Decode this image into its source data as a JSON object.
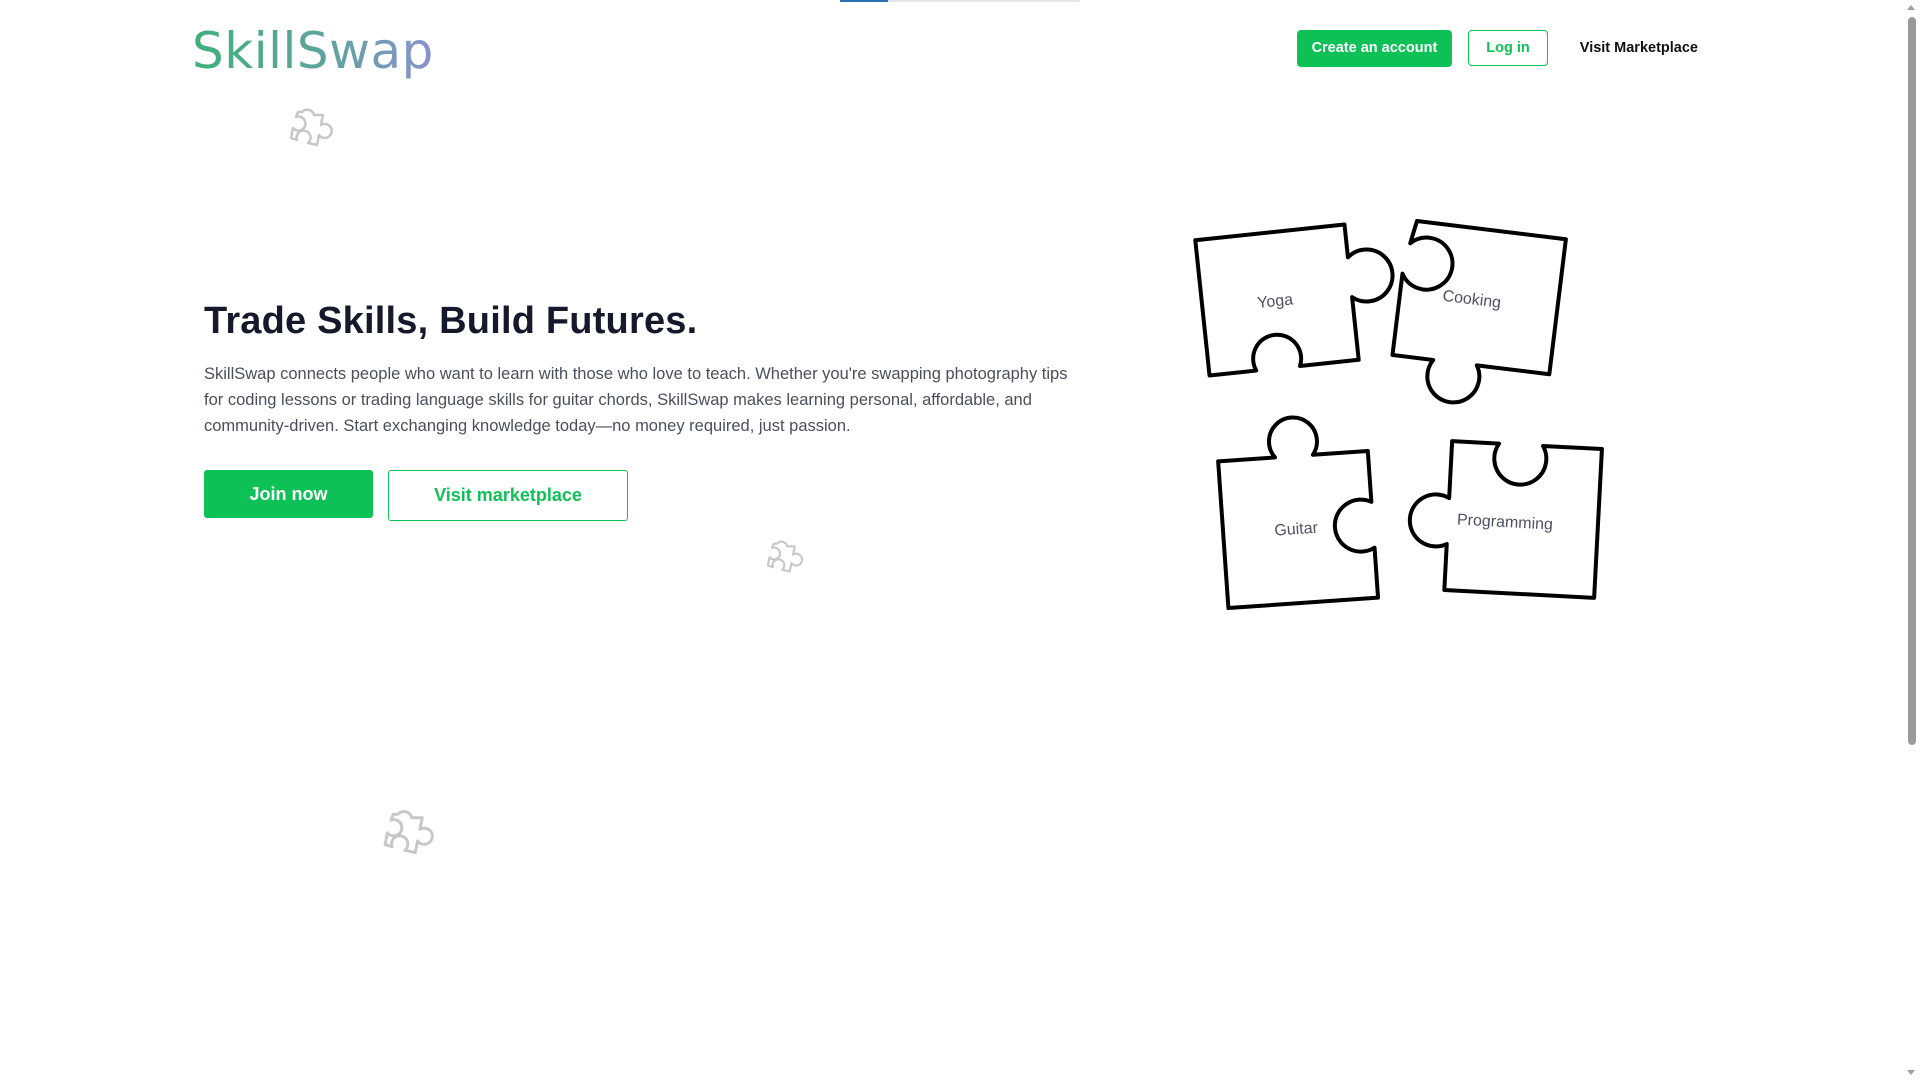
{
  "app": {
    "logo": "SkillSwap",
    "page_load_progress": 0.2
  },
  "header": {
    "create_account_label": "Create an account",
    "login_label": "Log in",
    "visit_marketplace_label": "Visit Marketplace"
  },
  "hero": {
    "title": "Trade Skills, Build Futures.",
    "description": "SkillSwap connects people who want to learn with those who love to teach. Whether you're swapping photography tips for coding lessons or trading language skills for guitar chords, SkillSwap makes learning personal, affordable, and community-driven. Start exchanging knowledge today—no money required, just passion.",
    "join_label": "Join now",
    "visit_label": "Visit marketplace"
  },
  "illustration": {
    "pieces": [
      {
        "label": "Yoga"
      },
      {
        "label": "Cooking"
      },
      {
        "label": "Guitar"
      },
      {
        "label": "Programming"
      }
    ],
    "decorative_icons": [
      "puzzle-outline-icon",
      "puzzle-outline-icon",
      "puzzle-outline-icon"
    ]
  },
  "colors": {
    "brand_green": "#0ec157",
    "heading": "#16192c",
    "body_text": "#4a4f5c",
    "logo_gradient_start": "#3fb07a",
    "logo_gradient_end": "#8a92cf"
  }
}
